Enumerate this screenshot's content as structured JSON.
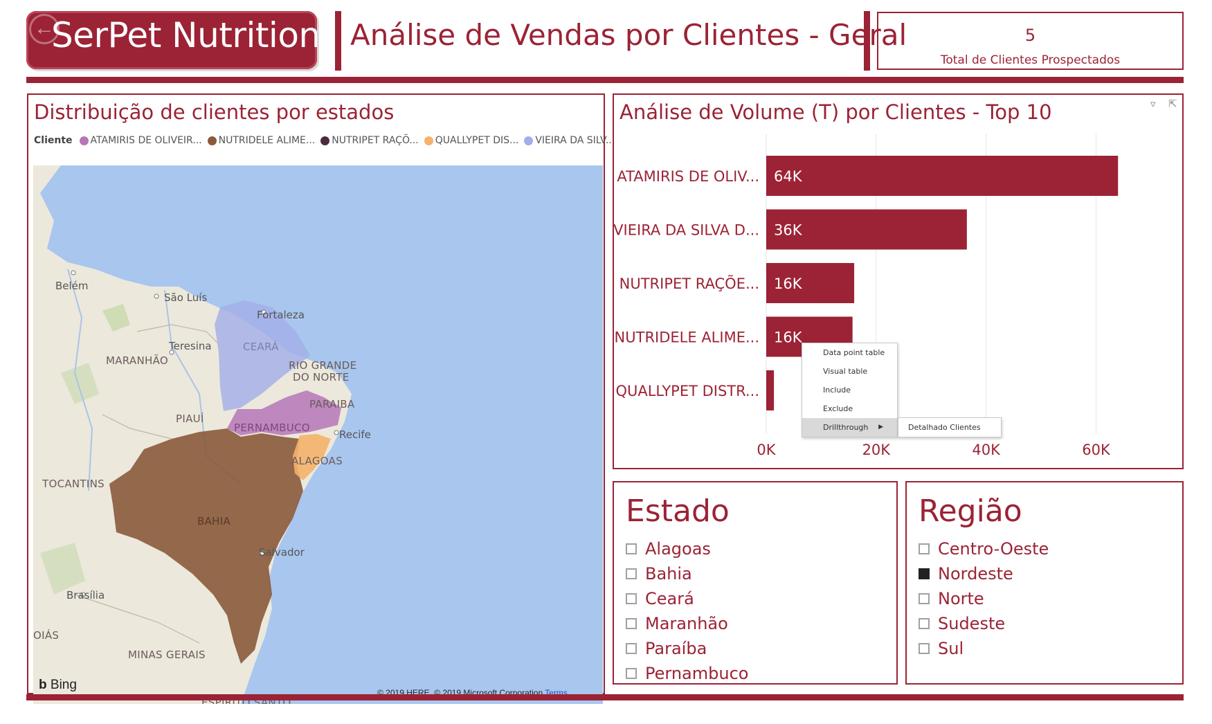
{
  "header": {
    "logo_text": "SerPet Nutrition",
    "title": "Análise de Vendas por Clientes - Geral",
    "kpi_value": "5",
    "kpi_label": "Total de Clientes Prospectados"
  },
  "map_panel": {
    "title": "Distribuição de clientes por estados",
    "legend_title": "Cliente",
    "legend": [
      {
        "label": "ATAMIRIS DE OLIVEIR...",
        "color": "#b676b8"
      },
      {
        "label": "NUTRIDELE ALIME...",
        "color": "#8a5a3b"
      },
      {
        "label": "NUTRIPET RAÇÕ...",
        "color": "#4a2c3d"
      },
      {
        "label": "QUALLYPET DIS...",
        "color": "#f4b26a"
      },
      {
        "label": "VIEIRA DA SILV...",
        "color": "#a3aee9"
      }
    ],
    "cities": [
      "Belém",
      "São Luís",
      "Fortaleza",
      "Teresina",
      "Recife",
      "Salvador",
      "Brasília"
    ],
    "states": [
      "MARANHÃO",
      "CEARÁ",
      "RIO GRANDE",
      "DO NORTE",
      "PARAIBA",
      "PIAUÍ",
      "PERNAMBUCO",
      "ALAGOAS",
      "TOCANTINS",
      "BAHIA",
      "OIÁS",
      "MINAS GERAIS",
      "ESPIRITO SANTO"
    ],
    "bing": "Bing",
    "copyright": "© 2019 HERE, © 2019 Microsoft Corporation",
    "terms": "Terms"
  },
  "bar_panel": {
    "title": "Análise de Volume (T) por Clientes - Top 10",
    "filter_icon": "filter-icon",
    "focus_icon": "focus-mode-icon"
  },
  "chart_data": {
    "type": "bar",
    "orientation": "horizontal",
    "title": "Análise de Volume (T) por Clientes - Top 10",
    "categories": [
      "ATAMIRIS DE OLIV...",
      "VIEIRA DA SILVA D...",
      "NUTRIPET RAÇÕE...",
      "NUTRIDELE ALIME...",
      "QUALLYPET DISTR..."
    ],
    "values": [
      64000,
      36500,
      16000,
      15700,
      1400
    ],
    "value_labels": [
      "64K",
      "36K",
      "16K",
      "16K",
      ""
    ],
    "xticks": [
      0,
      20000,
      40000,
      60000
    ],
    "xtick_labels": [
      "0K",
      "20K",
      "40K",
      "60K"
    ],
    "xlim": [
      0,
      68000
    ],
    "bar_color": "#9b2335",
    "grid": true
  },
  "context_menu": {
    "items": [
      "Data point table",
      "Visual table",
      "Include",
      "Exclude",
      "Drillthrough"
    ],
    "submenu": [
      "Detalhado Clientes"
    ]
  },
  "estado_slicer": {
    "title": "Estado",
    "items": [
      {
        "label": "Alagoas",
        "checked": false
      },
      {
        "label": "Bahia",
        "checked": false
      },
      {
        "label": "Ceará",
        "checked": false
      },
      {
        "label": "Maranhão",
        "checked": false
      },
      {
        "label": "Paraíba",
        "checked": false
      },
      {
        "label": "Pernambuco",
        "checked": false
      }
    ]
  },
  "regiao_slicer": {
    "title": "Região",
    "items": [
      {
        "label": "Centro-Oeste",
        "checked": false
      },
      {
        "label": "Nordeste",
        "checked": true
      },
      {
        "label": "Norte",
        "checked": false
      },
      {
        "label": "Sudeste",
        "checked": false
      },
      {
        "label": "Sul",
        "checked": false
      }
    ]
  }
}
